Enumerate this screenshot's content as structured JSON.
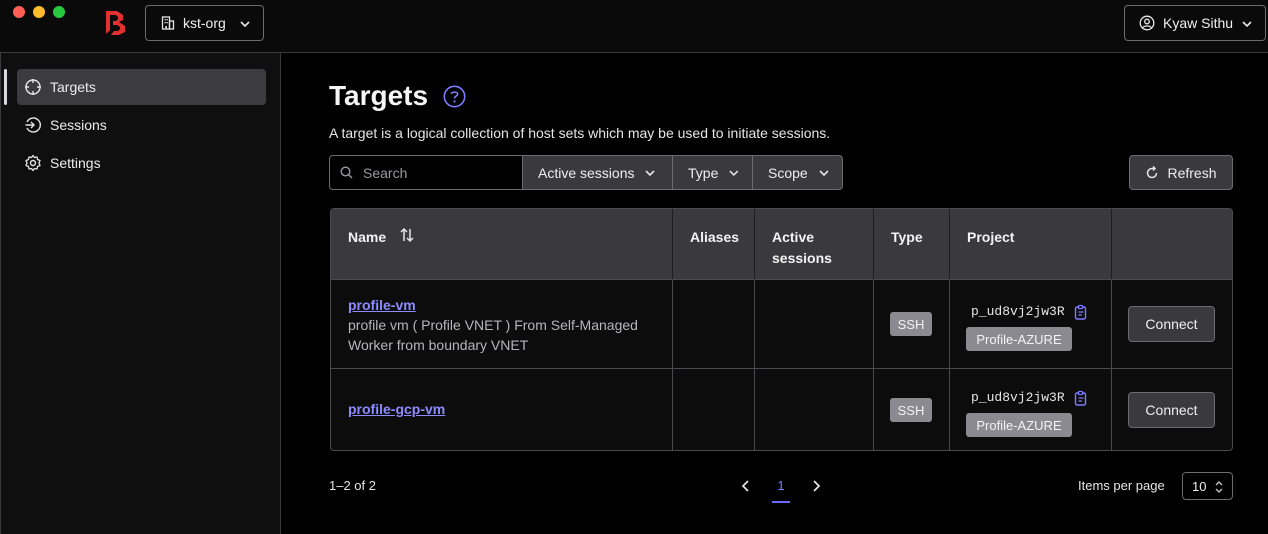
{
  "header": {
    "org_name": "kst-org",
    "user_name": "Kyaw Sithu"
  },
  "sidebar": {
    "items": [
      {
        "label": "Targets",
        "icon": "crosshair-icon",
        "active": true
      },
      {
        "label": "Sessions",
        "icon": "session-icon",
        "active": false
      },
      {
        "label": "Settings",
        "icon": "gear-icon",
        "active": false
      }
    ]
  },
  "page": {
    "title": "Targets",
    "subtitle": "A target is a logical collection of host sets which may be used to initiate sessions."
  },
  "filters": {
    "search_placeholder": "Search",
    "active_sessions": "Active sessions",
    "type": "Type",
    "scope": "Scope",
    "refresh": "Refresh"
  },
  "table": {
    "columns": [
      "Name",
      "Aliases",
      "Active sessions",
      "Type",
      "Project",
      ""
    ],
    "rows": [
      {
        "name": "profile-vm",
        "description": "profile vm ( Profile VNET ) From Self-Managed Worker from boundary VNET",
        "aliases": "",
        "active_sessions": "",
        "type": "SSH",
        "project_id": "p_ud8vj2jw3R",
        "project_name": "Profile-AZURE",
        "action": "Connect"
      },
      {
        "name": "profile-gcp-vm",
        "description": "",
        "aliases": "",
        "active_sessions": "",
        "type": "SSH",
        "project_id": "p_ud8vj2jw3R",
        "project_name": "Profile-AZURE",
        "action": "Connect"
      }
    ]
  },
  "pagination": {
    "range": "1–2 of 2",
    "current_page": "1",
    "items_per_page_label": "Items per page",
    "items_per_page": "10"
  },
  "colors": {
    "accent": "#7c7cff",
    "brand": "#e1322f"
  }
}
